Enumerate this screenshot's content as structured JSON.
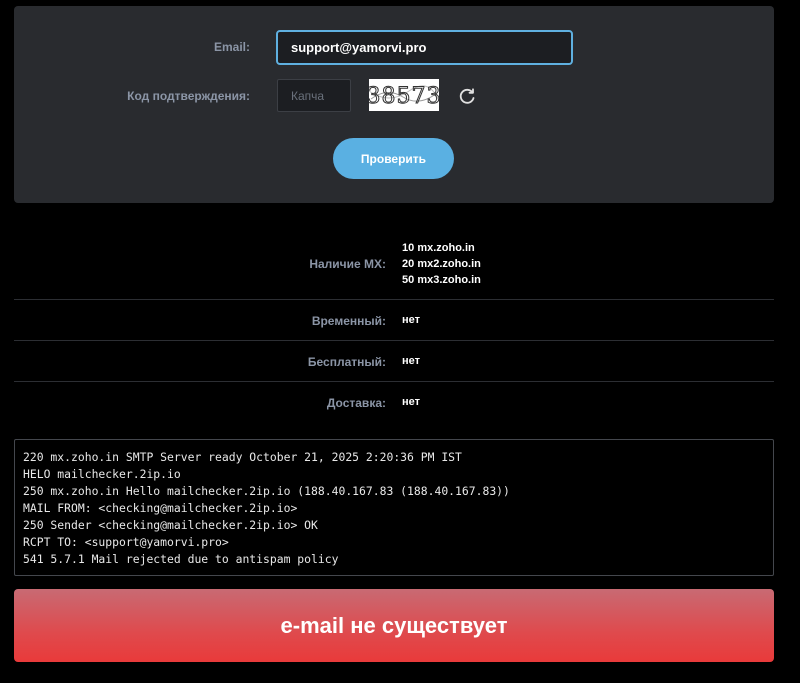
{
  "form": {
    "email_label": "Email:",
    "email_value": "support@yamorvi.pro",
    "captcha_label": "Код подтверждения:",
    "captcha_placeholder": "Капча",
    "captcha_text": "38573",
    "refresh_icon": "refresh-icon",
    "check_button_label": "Проверить"
  },
  "results": {
    "mx": {
      "label": "Наличие MX:",
      "records": [
        {
          "priority": "10",
          "host": "mx.zoho.in"
        },
        {
          "priority": "20",
          "host": "mx2.zoho.in"
        },
        {
          "priority": "50",
          "host": "mx3.zoho.in"
        }
      ]
    },
    "temporary": {
      "label": "Временный:",
      "value": "нет"
    },
    "free": {
      "label": "Бесплатный:",
      "value": "нет"
    },
    "delivery": {
      "label": "Доставка:",
      "value": "нет"
    }
  },
  "smtp_log": [
    "220 mx.zoho.in SMTP Server ready October 21, 2025 2:20:36 PM IST",
    "HELO mailchecker.2ip.io",
    "250 mx.zoho.in Hello mailchecker.2ip.io (188.40.167.83 (188.40.167.83))",
    "MAIL FROM: <checking@mailchecker.2ip.io>",
    "250 Sender <checking@mailchecker.2ip.io> OK",
    "RCPT TO: <support@yamorvi.pro>",
    "541 5.7.1 Mail rejected due to antispam policy"
  ],
  "verdict": {
    "text": "e-mail не существует",
    "color": "#e53b3b"
  },
  "colors": {
    "accent": "#5ab0e2",
    "panel": "#292b2f",
    "label": "#8b95a6"
  }
}
